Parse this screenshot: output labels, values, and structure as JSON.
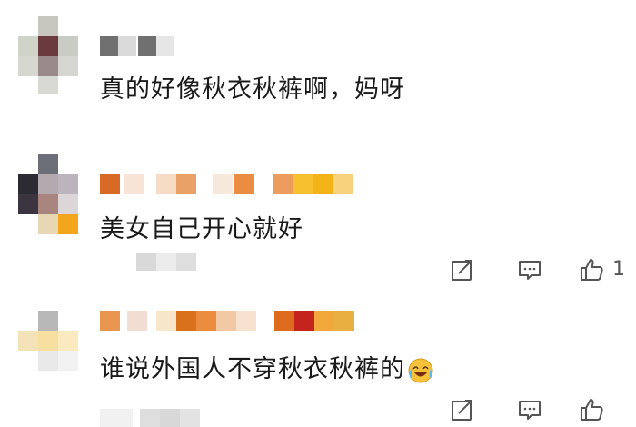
{
  "comments": [
    {
      "text": "真的好像秋衣秋裤啊，妈呀",
      "likes": ""
    },
    {
      "text": "美女自己开心就好",
      "likes": "1"
    },
    {
      "text": "谁说外国人不穿秋衣秋裤的",
      "emoji": "laughing-crying-emoji",
      "likes": ""
    }
  ],
  "icons": {
    "reply": "reply-icon",
    "comment": "comment-icon",
    "like": "thumbs-up-icon"
  },
  "colors": {
    "text": "#1a1a1a",
    "icon": "#555555",
    "divider": "#eeeeee",
    "name_orange": "#e07b2a",
    "name_yellow": "#f5b820"
  }
}
